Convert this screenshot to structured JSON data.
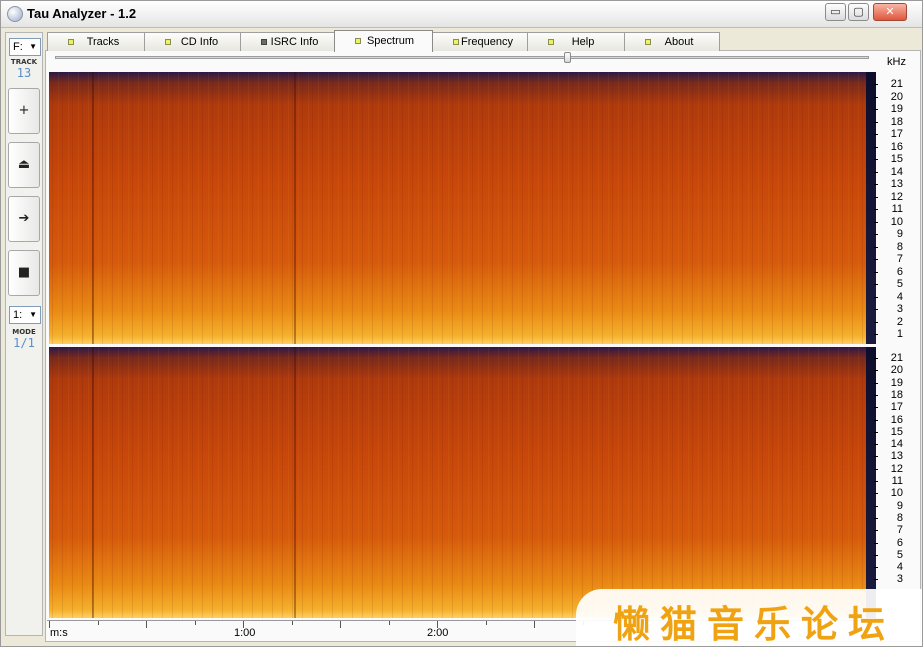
{
  "window": {
    "title": "Tau Analyzer - 1.2",
    "minimize_glyph": "▭",
    "maximize_glyph": "▢",
    "close_glyph": "✕"
  },
  "left_toolbar": {
    "drive": "F:",
    "track_label": "TRACK",
    "track_number": "13",
    "buttons": [
      {
        "name": "add",
        "glyph": "+"
      },
      {
        "name": "eject",
        "glyph": "⏏"
      },
      {
        "name": "play",
        "glyph": "➔"
      },
      {
        "name": "stop",
        "glyph": "■"
      }
    ],
    "mode_select": "1:",
    "mode_label": "MODE",
    "mode_value": "1/1"
  },
  "tabs": [
    {
      "label": "Tracks",
      "active": false
    },
    {
      "label": "CD Info",
      "active": false
    },
    {
      "label": "ISRC Info",
      "active": false
    },
    {
      "label": "Spectrum",
      "active": true
    },
    {
      "label": "Frequency",
      "active": false
    },
    {
      "label": "Help",
      "active": false
    },
    {
      "label": "About",
      "active": false
    }
  ],
  "spectrum": {
    "unit": "kHz",
    "channel1_labels": [
      "21",
      "20",
      "19",
      "18",
      "17",
      "16",
      "15",
      "14",
      "13",
      "12",
      "11",
      "10",
      "9",
      "8",
      "7",
      "6",
      "5",
      "4",
      "3",
      "2",
      "1"
    ],
    "channel2_labels": [
      "21",
      "20",
      "19",
      "18",
      "17",
      "16",
      "15",
      "14",
      "13",
      "12",
      "11",
      "10",
      "9",
      "8",
      "7",
      "6",
      "5",
      "4",
      "3"
    ],
    "time_axis_unit": "m:s",
    "time_labels": [
      "1:00",
      "2:00"
    ]
  },
  "watermark": "懒猫音乐论坛",
  "colors": {
    "spectrum_low": "#ffd060",
    "spectrum_mid": "#c8470a",
    "spectrum_high": "#2b1848",
    "watermark": "#f0a312"
  }
}
